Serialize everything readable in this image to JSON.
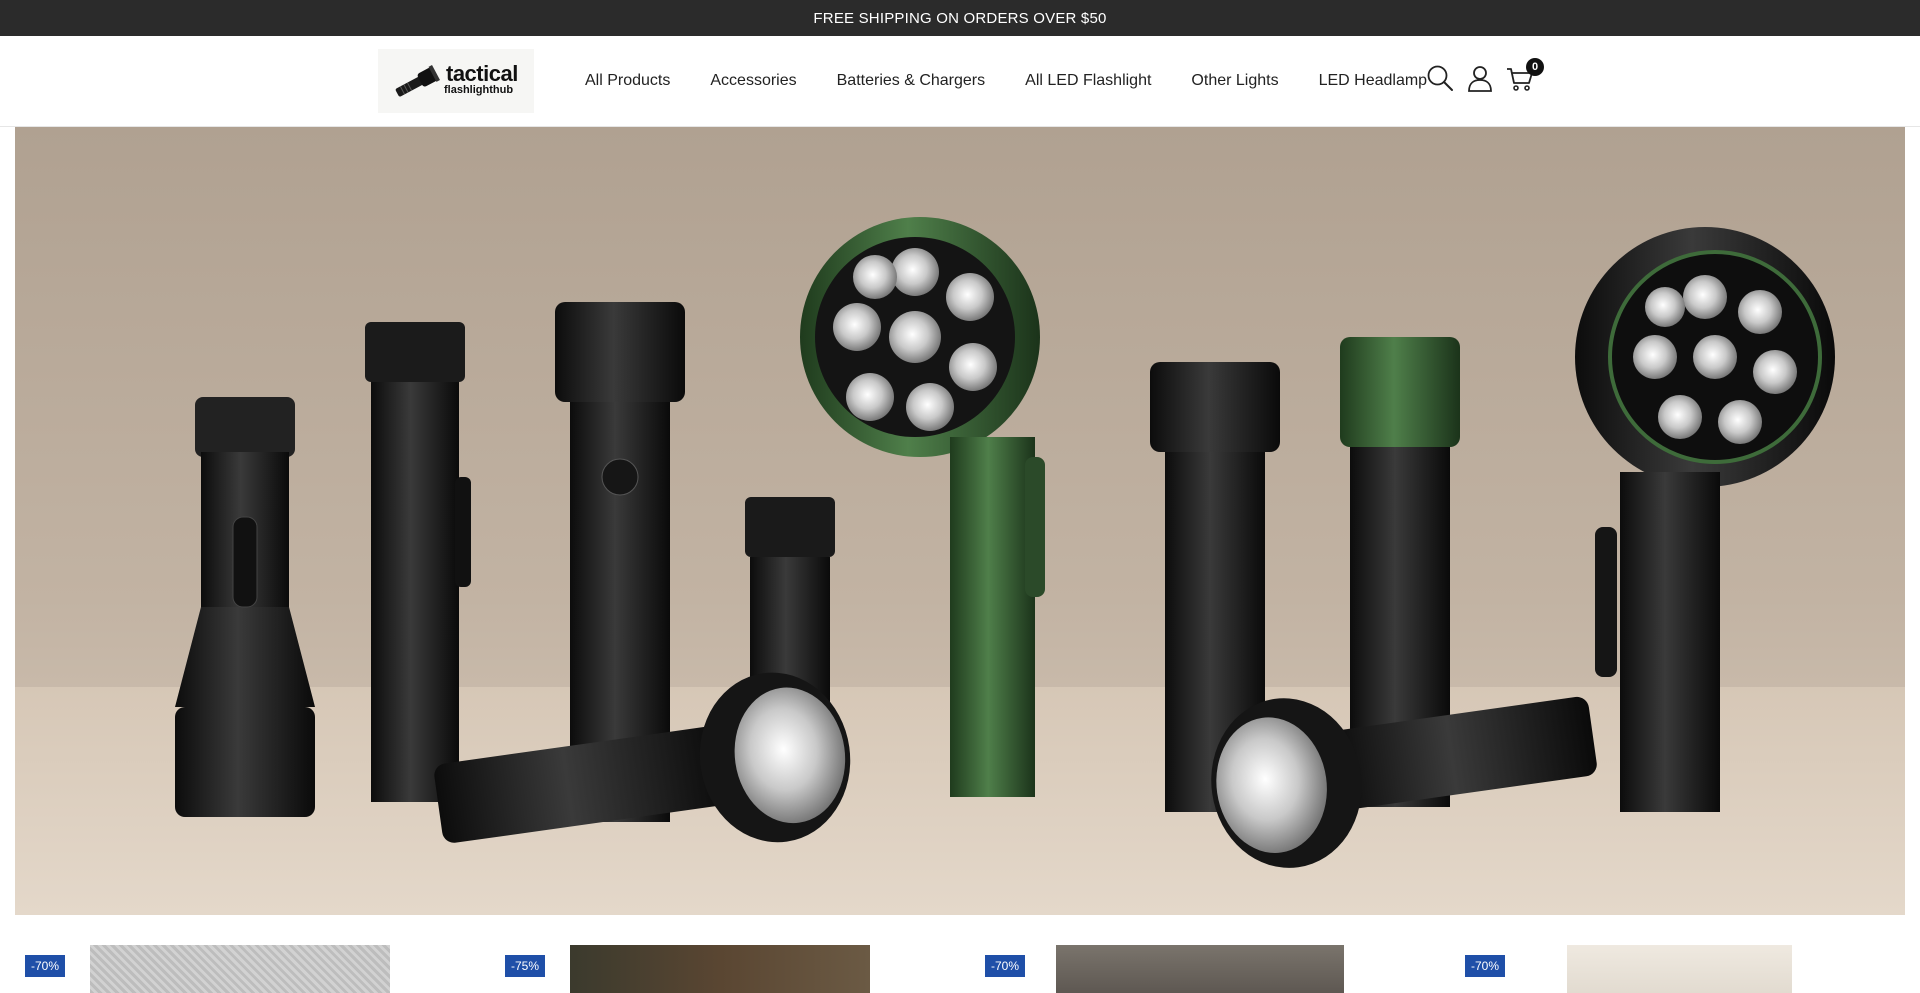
{
  "announcement": {
    "text": "FREE SHIPPING ON ORDERS OVER $50"
  },
  "brand": {
    "logo_line1": "tactical",
    "logo_line2": "flashlighthub"
  },
  "nav": {
    "items": [
      {
        "label": "All Products"
      },
      {
        "label": "Accessories"
      },
      {
        "label": "Batteries & Chargers"
      },
      {
        "label": "All LED Flashlight"
      },
      {
        "label": "Other Lights"
      },
      {
        "label": "LED Headlamp"
      }
    ]
  },
  "header_icons": {
    "search": "search-icon",
    "account": "user-icon",
    "cart": "cart-icon",
    "cart_count": "0"
  },
  "hero": {
    "image": "flashlight-collection-banner"
  },
  "products": [
    {
      "badge": "-70%",
      "image": "product-thumbnail-gravel"
    },
    {
      "badge": "-75%",
      "image": "product-thumbnail-holster"
    },
    {
      "badge": "-70%",
      "image": "product-thumbnail-box"
    },
    {
      "badge": "-70%",
      "image": "product-thumbnail-package"
    }
  ],
  "colors": {
    "announce_bg": "#2b2b2b",
    "badge_bg": "#1f4fa8",
    "accent_green": "#3c6b3a"
  }
}
